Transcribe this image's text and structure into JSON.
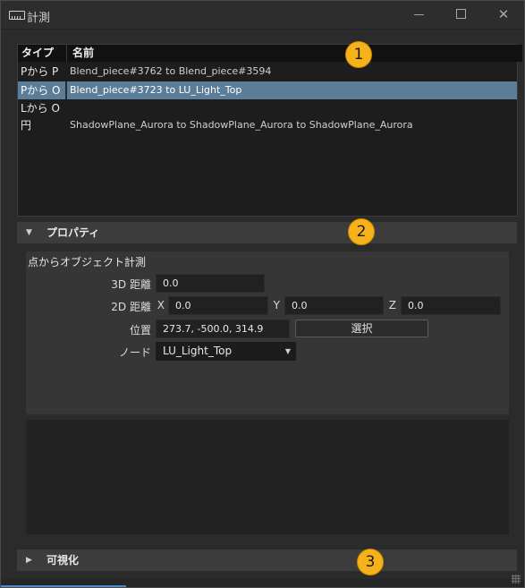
{
  "window": {
    "title": "計測"
  },
  "table": {
    "headers": {
      "type": "タイプ",
      "name": "名前"
    },
    "rows": [
      {
        "type": "Pから P",
        "name": "Blend_piece#3762  to  Blend_piece#3594",
        "selected": false
      },
      {
        "type": "Pから O",
        "name": "Blend_piece#3723  to  LU_Light_Top",
        "selected": true
      },
      {
        "type": "Lから O",
        "name": "",
        "selected": false
      },
      {
        "type": "円",
        "name": "ShadowPlane_Aurora  to  ShadowPlane_Aurora  to  ShadowPlane_Aurora",
        "selected": false
      }
    ]
  },
  "badges": [
    "1",
    "2",
    "3"
  ],
  "properties": {
    "header": "プロパティ",
    "subtitle": "点からオブジェクト計測",
    "distance3d_label": "3D 距離",
    "distance3d_value": "0.0",
    "distance2d_label": "2D 距離",
    "x_label": "X",
    "x_value": "0.0",
    "y_label": "Y",
    "y_value": "0.0",
    "z_label": "Z",
    "z_value": "0.0",
    "position_label": "位置",
    "position_value": "273.7, -500.0, 314.9",
    "select_button": "選択",
    "node_label": "ノード",
    "node_value": "LU_Light_Top"
  },
  "visualization": {
    "header": "可視化"
  },
  "colors": {
    "accent": "#f6b21a",
    "selection": "#5c7d98",
    "background": "#2b2b2b"
  }
}
